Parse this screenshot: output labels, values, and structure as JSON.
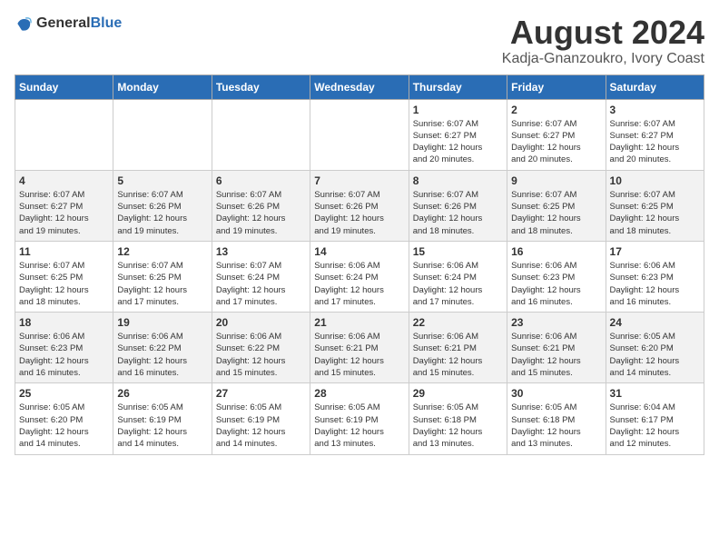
{
  "header": {
    "logo": {
      "general": "General",
      "blue": "Blue"
    },
    "title": "August 2024",
    "subtitle": "Kadja-Gnanzoukro, Ivory Coast"
  },
  "calendar": {
    "days_of_week": [
      "Sunday",
      "Monday",
      "Tuesday",
      "Wednesday",
      "Thursday",
      "Friday",
      "Saturday"
    ],
    "weeks": [
      [
        {
          "day": "",
          "info": ""
        },
        {
          "day": "",
          "info": ""
        },
        {
          "day": "",
          "info": ""
        },
        {
          "day": "",
          "info": ""
        },
        {
          "day": "1",
          "info": "Sunrise: 6:07 AM\nSunset: 6:27 PM\nDaylight: 12 hours\nand 20 minutes."
        },
        {
          "day": "2",
          "info": "Sunrise: 6:07 AM\nSunset: 6:27 PM\nDaylight: 12 hours\nand 20 minutes."
        },
        {
          "day": "3",
          "info": "Sunrise: 6:07 AM\nSunset: 6:27 PM\nDaylight: 12 hours\nand 20 minutes."
        }
      ],
      [
        {
          "day": "4",
          "info": "Sunrise: 6:07 AM\nSunset: 6:27 PM\nDaylight: 12 hours\nand 19 minutes."
        },
        {
          "day": "5",
          "info": "Sunrise: 6:07 AM\nSunset: 6:26 PM\nDaylight: 12 hours\nand 19 minutes."
        },
        {
          "day": "6",
          "info": "Sunrise: 6:07 AM\nSunset: 6:26 PM\nDaylight: 12 hours\nand 19 minutes."
        },
        {
          "day": "7",
          "info": "Sunrise: 6:07 AM\nSunset: 6:26 PM\nDaylight: 12 hours\nand 19 minutes."
        },
        {
          "day": "8",
          "info": "Sunrise: 6:07 AM\nSunset: 6:26 PM\nDaylight: 12 hours\nand 18 minutes."
        },
        {
          "day": "9",
          "info": "Sunrise: 6:07 AM\nSunset: 6:25 PM\nDaylight: 12 hours\nand 18 minutes."
        },
        {
          "day": "10",
          "info": "Sunrise: 6:07 AM\nSunset: 6:25 PM\nDaylight: 12 hours\nand 18 minutes."
        }
      ],
      [
        {
          "day": "11",
          "info": "Sunrise: 6:07 AM\nSunset: 6:25 PM\nDaylight: 12 hours\nand 18 minutes."
        },
        {
          "day": "12",
          "info": "Sunrise: 6:07 AM\nSunset: 6:25 PM\nDaylight: 12 hours\nand 17 minutes."
        },
        {
          "day": "13",
          "info": "Sunrise: 6:07 AM\nSunset: 6:24 PM\nDaylight: 12 hours\nand 17 minutes."
        },
        {
          "day": "14",
          "info": "Sunrise: 6:06 AM\nSunset: 6:24 PM\nDaylight: 12 hours\nand 17 minutes."
        },
        {
          "day": "15",
          "info": "Sunrise: 6:06 AM\nSunset: 6:24 PM\nDaylight: 12 hours\nand 17 minutes."
        },
        {
          "day": "16",
          "info": "Sunrise: 6:06 AM\nSunset: 6:23 PM\nDaylight: 12 hours\nand 16 minutes."
        },
        {
          "day": "17",
          "info": "Sunrise: 6:06 AM\nSunset: 6:23 PM\nDaylight: 12 hours\nand 16 minutes."
        }
      ],
      [
        {
          "day": "18",
          "info": "Sunrise: 6:06 AM\nSunset: 6:23 PM\nDaylight: 12 hours\nand 16 minutes."
        },
        {
          "day": "19",
          "info": "Sunrise: 6:06 AM\nSunset: 6:22 PM\nDaylight: 12 hours\nand 16 minutes."
        },
        {
          "day": "20",
          "info": "Sunrise: 6:06 AM\nSunset: 6:22 PM\nDaylight: 12 hours\nand 15 minutes."
        },
        {
          "day": "21",
          "info": "Sunrise: 6:06 AM\nSunset: 6:21 PM\nDaylight: 12 hours\nand 15 minutes."
        },
        {
          "day": "22",
          "info": "Sunrise: 6:06 AM\nSunset: 6:21 PM\nDaylight: 12 hours\nand 15 minutes."
        },
        {
          "day": "23",
          "info": "Sunrise: 6:06 AM\nSunset: 6:21 PM\nDaylight: 12 hours\nand 15 minutes."
        },
        {
          "day": "24",
          "info": "Sunrise: 6:05 AM\nSunset: 6:20 PM\nDaylight: 12 hours\nand 14 minutes."
        }
      ],
      [
        {
          "day": "25",
          "info": "Sunrise: 6:05 AM\nSunset: 6:20 PM\nDaylight: 12 hours\nand 14 minutes."
        },
        {
          "day": "26",
          "info": "Sunrise: 6:05 AM\nSunset: 6:19 PM\nDaylight: 12 hours\nand 14 minutes."
        },
        {
          "day": "27",
          "info": "Sunrise: 6:05 AM\nSunset: 6:19 PM\nDaylight: 12 hours\nand 14 minutes."
        },
        {
          "day": "28",
          "info": "Sunrise: 6:05 AM\nSunset: 6:19 PM\nDaylight: 12 hours\nand 13 minutes."
        },
        {
          "day": "29",
          "info": "Sunrise: 6:05 AM\nSunset: 6:18 PM\nDaylight: 12 hours\nand 13 minutes."
        },
        {
          "day": "30",
          "info": "Sunrise: 6:05 AM\nSunset: 6:18 PM\nDaylight: 12 hours\nand 13 minutes."
        },
        {
          "day": "31",
          "info": "Sunrise: 6:04 AM\nSunset: 6:17 PM\nDaylight: 12 hours\nand 12 minutes."
        }
      ]
    ]
  }
}
